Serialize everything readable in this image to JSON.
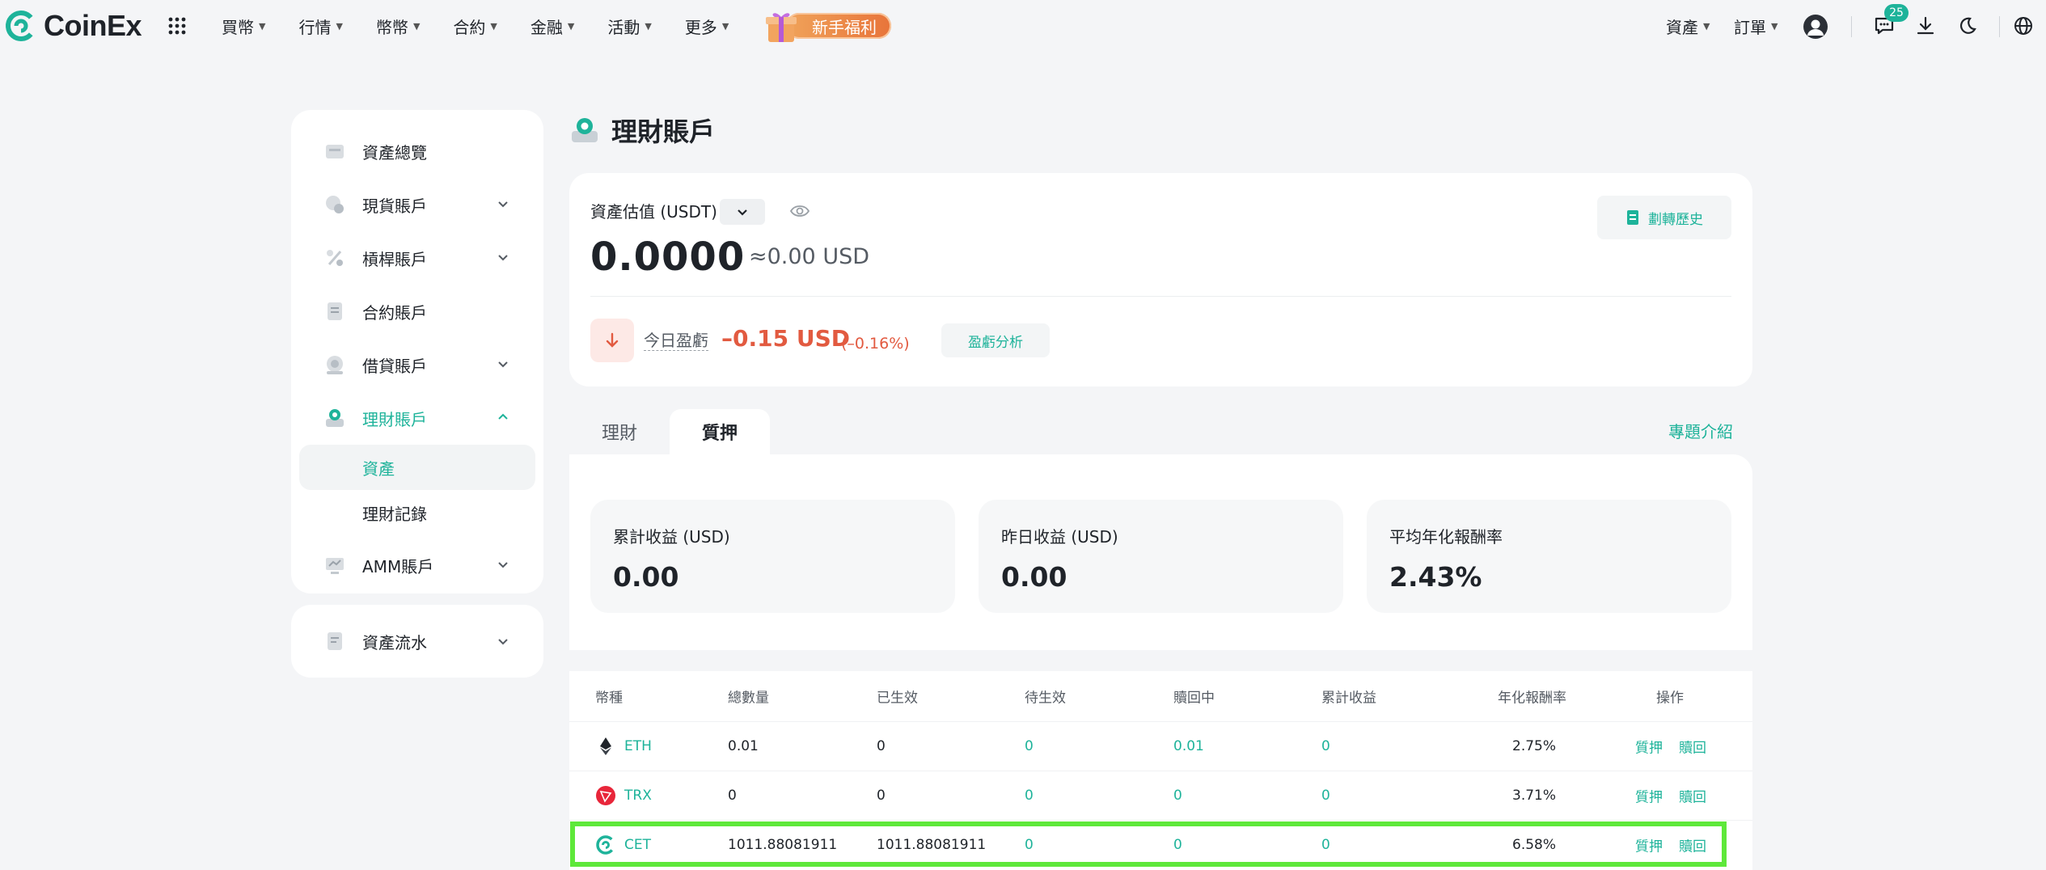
{
  "brand": {
    "name": "CoinEx"
  },
  "nav": {
    "items": [
      "買幣",
      "行情",
      "幣幣",
      "合約",
      "金融",
      "活動",
      "更多"
    ],
    "promo_label": "新手福利"
  },
  "right_nav": {
    "assets": "資產",
    "orders": "訂單",
    "message_count": "25"
  },
  "sidebar": {
    "items": [
      {
        "label": "資產總覽",
        "icon": "overview-icon",
        "expandable": false
      },
      {
        "label": "現貨賬戶",
        "icon": "spot-icon",
        "expandable": true
      },
      {
        "label": "槓桿賬戶",
        "icon": "margin-icon",
        "expandable": true
      },
      {
        "label": "合約賬戶",
        "icon": "futures-icon",
        "expandable": false
      },
      {
        "label": "借貸賬戶",
        "icon": "loan-icon",
        "expandable": true
      },
      {
        "label": "理財賬戶",
        "icon": "finance-icon",
        "expandable": true,
        "active": true
      },
      {
        "label": "AMM賬戶",
        "icon": "amm-icon",
        "expandable": true
      }
    ],
    "subitems": [
      "資產",
      "理財記錄"
    ],
    "history": "資產流水"
  },
  "page": {
    "title": "理財賬戶"
  },
  "summary": {
    "est_label": "資產估值 (USDT)",
    "value": "0.0000",
    "approx": "≈0.00 USD",
    "transfer_label": "劃轉歷史",
    "pnl_label": "今日盈虧",
    "pnl_value": "–0.15 USD",
    "pnl_pct": "(–0.16%)",
    "pnl_button": "盈虧分析"
  },
  "tabs": [
    "理財",
    "質押"
  ],
  "topic_link": "專題介紹",
  "stats": [
    {
      "label": "累計收益 (USD)",
      "value": "0.00"
    },
    {
      "label": "昨日收益 (USD)",
      "value": "0.00"
    },
    {
      "label": "平均年化報酬率",
      "value": "2.43%"
    }
  ],
  "table": {
    "headers": [
      "幣種",
      "總數量",
      "已生效",
      "待生效",
      "贖回中",
      "累計收益",
      "年化報酬率",
      "操作"
    ],
    "actions": [
      "質押",
      "贖回"
    ],
    "rows": [
      {
        "coin": "ETH",
        "total": "0.01",
        "active": "0",
        "pending": "0",
        "redeeming": "0.01",
        "earned": "0",
        "apr": "2.75%"
      },
      {
        "coin": "TRX",
        "total": "0",
        "active": "0",
        "pending": "0",
        "redeeming": "0",
        "earned": "0",
        "apr": "3.71%"
      },
      {
        "coin": "CET",
        "total": "1011.88081911",
        "active": "1011.88081911",
        "pending": "0",
        "redeeming": "0",
        "earned": "0",
        "apr": "6.58%"
      }
    ]
  },
  "colors": {
    "accent": "#1eb39a",
    "loss": "#e25a40",
    "highlight": "#5ee83a"
  }
}
